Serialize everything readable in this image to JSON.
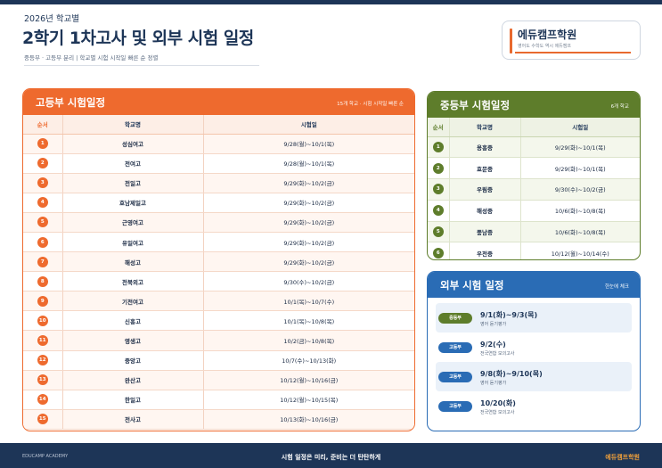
{
  "header": {
    "year": "2026년 학교별",
    "title": "2학기 1차고사 및 외부 시험 일정",
    "subtitle": "중등부 · 고등부 분리  |  학교별 시험 시작일 빠른 순 정렬"
  },
  "logo": {
    "name": "에듀캠프학원",
    "tagline": "영어도 수학도 역시 에듀캠프",
    "accent_color": "#e8692e"
  },
  "high": {
    "title": "고등부 시험일정",
    "note": "15개 학교 · 시험 시작일 빠른 순",
    "columns": [
      "순서",
      "학교명",
      "시험일"
    ],
    "color": "#ee6a2e",
    "rows": [
      {
        "n": "1",
        "school": "성심여고",
        "date": "9/28(월)~10/1(목)"
      },
      {
        "n": "2",
        "school": "전여고",
        "date": "9/28(월)~10/1(목)"
      },
      {
        "n": "3",
        "school": "전일고",
        "date": "9/29(화)~10/2(금)"
      },
      {
        "n": "4",
        "school": "호남제일고",
        "date": "9/29(화)~10/2(금)"
      },
      {
        "n": "5",
        "school": "근영여고",
        "date": "9/29(화)~10/2(금)"
      },
      {
        "n": "6",
        "school": "유일여고",
        "date": "9/29(화)~10/2(금)"
      },
      {
        "n": "7",
        "school": "해성고",
        "date": "9/29(화)~10/2(금)"
      },
      {
        "n": "8",
        "school": "전북외고",
        "date": "9/30(수)~10/2(금)"
      },
      {
        "n": "9",
        "school": "기전여고",
        "date": "10/1(목)~10/7(수)"
      },
      {
        "n": "10",
        "school": "신흥고",
        "date": "10/1(목)~10/8(목)"
      },
      {
        "n": "11",
        "school": "영생고",
        "date": "10/2(금)~10/8(목)"
      },
      {
        "n": "12",
        "school": "중앙고",
        "date": "10/7(수)~10/13(화)"
      },
      {
        "n": "13",
        "school": "완산고",
        "date": "10/12(월)~10/16(금)"
      },
      {
        "n": "14",
        "school": "한일고",
        "date": "10/12(월)~10/15(목)"
      },
      {
        "n": "15",
        "school": "전사고",
        "date": "10/13(화)~10/16(금)"
      }
    ]
  },
  "mid": {
    "title": "중등부 시험일정",
    "note": "6개 학교",
    "columns": [
      "순서",
      "학교명",
      "시험일"
    ],
    "color": "#5e7d2b",
    "rows": [
      {
        "n": "1",
        "school": "용흥중",
        "date": "9/29(화)~10/1(목)"
      },
      {
        "n": "2",
        "school": "효문중",
        "date": "9/29(화)~10/1(목)"
      },
      {
        "n": "3",
        "school": "우림중",
        "date": "9/30(수)~10/2(금)"
      },
      {
        "n": "4",
        "school": "해성중",
        "date": "10/6(화)~10/8(목)"
      },
      {
        "n": "5",
        "school": "풍남중",
        "date": "10/6(화)~10/8(목)"
      },
      {
        "n": "6",
        "school": "우전중",
        "date": "10/12(월)~10/14(수)"
      }
    ]
  },
  "external": {
    "title": "외부 시험 일정",
    "note": "한눈에 체크",
    "color": "#2a6cb5",
    "items": [
      {
        "badge": "중등부",
        "badge_color": "green",
        "date": "9/1(화)~9/3(목)",
        "desc": "영어 듣기평가"
      },
      {
        "badge": "고등부",
        "badge_color": "blue",
        "date": "9/2(수)",
        "desc": "전국연합 모의고사"
      },
      {
        "badge": "고등부",
        "badge_color": "blue",
        "date": "9/8(화)~9/10(목)",
        "desc": "영어 듣기평가"
      },
      {
        "badge": "고등부",
        "badge_color": "blue",
        "date": "10/20(화)",
        "desc": "전국연합 모의고사"
      }
    ]
  },
  "footer": {
    "left": "EDUCAMP ACADEMY",
    "center": "시험 일정은 미리, 준비는 더 탄탄하게",
    "right": "에듀캠프학원"
  }
}
